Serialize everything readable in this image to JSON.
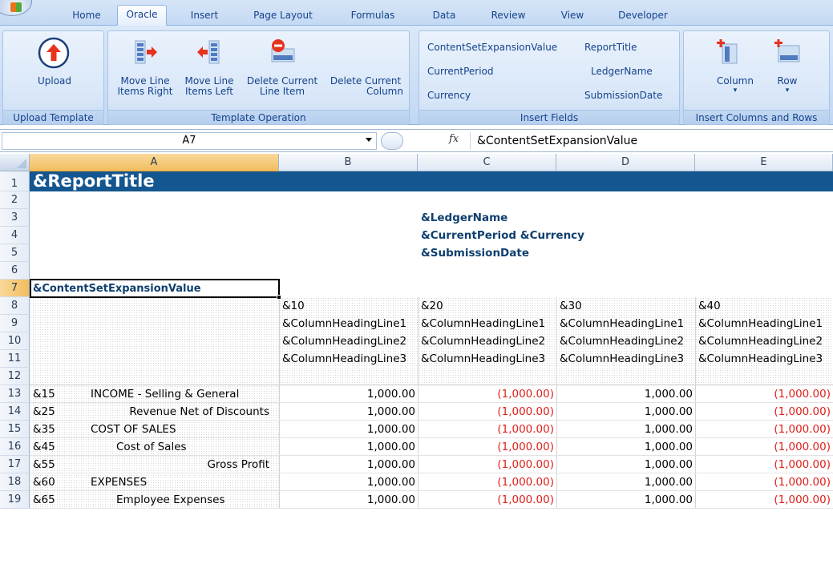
{
  "ribbon": {
    "tabs": [
      "Home",
      "Oracle",
      "Insert",
      "Page Layout",
      "Formulas",
      "Data",
      "Review",
      "View",
      "Developer"
    ],
    "active_tab": "Oracle",
    "groups": {
      "upload": {
        "title": "Upload Template",
        "upload_label": "Upload"
      },
      "template": {
        "title": "Template Operation",
        "move_right_l1": "Move Line",
        "move_right_l2": "Items Right",
        "move_left_l1": "Move Line",
        "move_left_l2": "Items Left",
        "delete_item_l1": "Delete Current",
        "delete_item_l2": "Line Item",
        "delete_col_l1": "Delete Current",
        "delete_col_l2": "Column"
      },
      "fields": {
        "title": "Insert Fields",
        "content_set": "ContentSetExpansionValue",
        "report_title": "ReportTitle",
        "current_period": "CurrentPeriod",
        "ledger_name": "LedgerName",
        "currency": "Currency",
        "submission_date": "SubmissionDate"
      },
      "insert": {
        "title": "Insert Columns and Rows",
        "column_label": "Column",
        "row_label": "Row"
      }
    }
  },
  "formula_bar": {
    "name_box": "A7",
    "fx": "fx",
    "value": "&ContentSetExpansionValue"
  },
  "columns": [
    "A",
    "B",
    "C",
    "D",
    "E"
  ],
  "selected": {
    "column": "A",
    "row": 7
  },
  "header": {
    "title": "&ReportTitle",
    "ledger": "&LedgerName",
    "period_currency": "&CurrentPeriod &Currency",
    "submission": "&SubmissionDate",
    "content_set": "&ContentSetExpansionValue"
  },
  "column_heads": {
    "codes": [
      "&10",
      "&20",
      "&30",
      "&40"
    ],
    "line1": "&ColumnHeadingLine1",
    "line2": "&ColumnHeadingLine2",
    "line3": "&ColumnHeadingLine3"
  },
  "line_items": [
    {
      "row": 13,
      "code": "&15",
      "label": "INCOME - Selling & General",
      "indent": "left",
      "values": [
        "1,000.00",
        "(1,000.00)",
        "1,000.00",
        "(1,000.00)"
      ]
    },
    {
      "row": 14,
      "code": "&25",
      "label": "Revenue Net of Discounts",
      "indent": "right",
      "values": [
        "1,000.00",
        "(1,000.00)",
        "1,000.00",
        "(1,000.00)"
      ]
    },
    {
      "row": 15,
      "code": "&35",
      "label": "COST OF SALES",
      "indent": "left",
      "values": [
        "1,000.00",
        "(1,000.00)",
        "1,000.00",
        "(1,000.00)"
      ]
    },
    {
      "row": 16,
      "code": "&45",
      "label": "Cost of Sales",
      "indent": "mid",
      "values": [
        "1,000.00",
        "(1,000.00)",
        "1,000.00",
        "(1,000.00)"
      ]
    },
    {
      "row": 17,
      "code": "&55",
      "label": "Gross Profit",
      "indent": "right",
      "values": [
        "1,000.00",
        "(1,000.00)",
        "1,000.00",
        "(1,000.00)"
      ]
    },
    {
      "row": 18,
      "code": "&60",
      "label": "EXPENSES",
      "indent": "left",
      "values": [
        "1,000.00",
        "(1,000.00)",
        "1,000.00",
        "(1,000.00)"
      ]
    },
    {
      "row": 19,
      "code": "&65",
      "label": "Employee Expenses",
      "indent": "mid",
      "values": [
        "1,000.00",
        "(1,000.00)",
        "1,000.00",
        "(1,000.00)"
      ]
    }
  ],
  "colors": {
    "title_bar": "#14568f",
    "negative": "#e0201b",
    "selection": "#f2bd5e"
  }
}
